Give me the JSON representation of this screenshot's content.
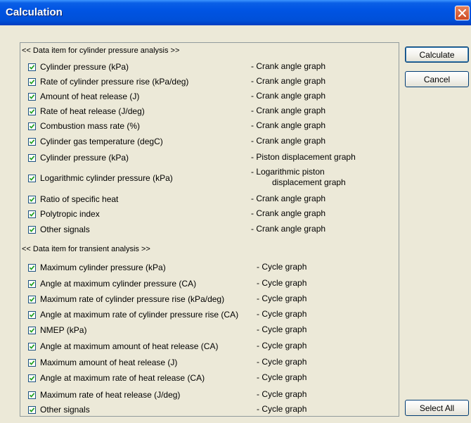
{
  "window": {
    "title": "Calculation"
  },
  "buttons": {
    "calculate": "Calculate",
    "cancel": "Cancel",
    "select_all": "Select All"
  },
  "cylinder": {
    "heading": "<< Data item for cylinder pressure analysis >>",
    "items": [
      {
        "label": "Cylinder pressure (kPa)",
        "graph": "- Crank angle graph",
        "checked": true
      },
      {
        "label": "Rate of cylinder pressure rise (kPa/deg)",
        "graph": "- Crank angle graph",
        "checked": true
      },
      {
        "label": "Amount of heat release (J)",
        "graph": "- Crank angle graph",
        "checked": true
      },
      {
        "label": "Rate of heat release (J/deg)",
        "graph": "- Crank angle graph",
        "checked": true
      },
      {
        "label": "Combustion mass rate (%)",
        "graph": "- Crank angle graph",
        "checked": true
      },
      {
        "label": "Cylinder gas temperature (degC)",
        "graph": "- Crank angle graph",
        "checked": true
      },
      {
        "label": "Cylinder pressure (kPa)",
        "graph": "- Piston displacement graph",
        "checked": true
      },
      {
        "label": "Logarithmic cylinder pressure (kPa)",
        "graph": "- Logarithmic piston",
        "graph2": "displacement graph",
        "checked": true
      },
      {
        "label": "Ratio of specific heat",
        "graph": "- Crank angle graph",
        "checked": true
      },
      {
        "label": "Polytropic index",
        "graph": "- Crank angle graph",
        "checked": true
      },
      {
        "label": "Other signals",
        "graph": "- Crank angle graph",
        "checked": true
      }
    ]
  },
  "transient": {
    "heading": "<< Data item for transient analysis >>",
    "items": [
      {
        "label": "Maximum cylinder pressure (kPa)",
        "graph": "- Cycle graph",
        "checked": true
      },
      {
        "label": "Angle at maximum cylinder pressure (CA)",
        "graph": "- Cycle graph",
        "checked": true
      },
      {
        "label": "Maximum rate of cylinder pressure rise (kPa/deg)",
        "graph": "- Cycle graph",
        "checked": true
      },
      {
        "label": "Angle at maximum rate of cylinder pressure rise (CA)",
        "graph": "- Cycle graph",
        "checked": true
      },
      {
        "label": "NMEP (kPa)",
        "graph": "- Cycle graph",
        "checked": true
      },
      {
        "label": "Angle at maximum amount of heat release (CA)",
        "graph": "- Cycle graph",
        "checked": true
      },
      {
        "label": "Maximum amount of heat release (J)",
        "graph": "- Cycle graph",
        "checked": true
      },
      {
        "label": "Angle at maximum rate of heat release (CA)",
        "graph": "- Cycle graph",
        "checked": true
      },
      {
        "label": "Maximum rate of heat release (J/deg)",
        "graph": "- Cycle graph",
        "checked": true
      },
      {
        "label": "Other signals",
        "graph": "- Cycle graph",
        "checked": true
      }
    ]
  }
}
